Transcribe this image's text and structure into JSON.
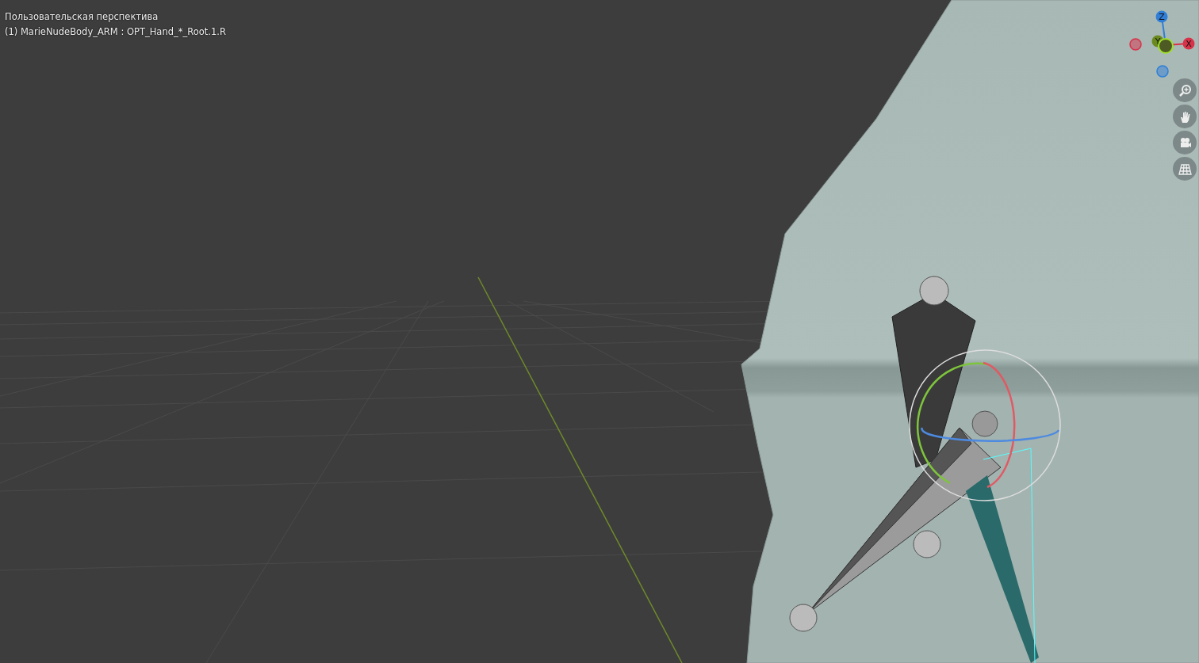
{
  "viewport": {
    "title": "Пользовательская перспектива",
    "object_info": "(1) MarieNudeBody_ARM : OPT_Hand_*_Root.1.R"
  },
  "axis_gizmo": {
    "axes": [
      {
        "label": "Z",
        "color": "#2f7fd8"
      },
      {
        "label": "Y",
        "color": "#6a8a1e"
      },
      {
        "label": "X",
        "color": "#d8324a"
      }
    ]
  },
  "nav_buttons": [
    {
      "kind": "zoom"
    },
    {
      "kind": "pan"
    },
    {
      "kind": "camera"
    },
    {
      "kind": "perspective"
    }
  ]
}
